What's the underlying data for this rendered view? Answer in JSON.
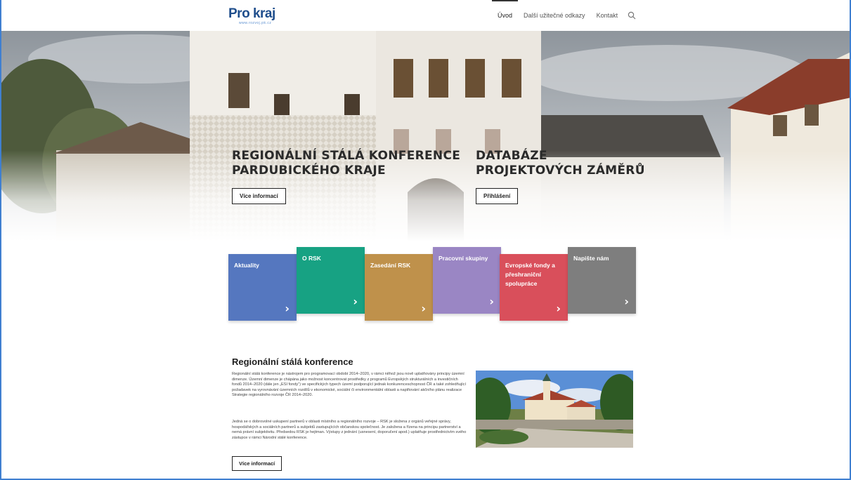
{
  "header": {
    "logo_text": "Pro kraj",
    "logo_subtitle": "www.rozvoj.pk.cz",
    "nav": [
      {
        "label": "Úvod",
        "active": true
      },
      {
        "label": "Další užitečné odkazy",
        "active": false
      },
      {
        "label": "Kontakt",
        "active": false
      }
    ],
    "search_icon": "search-icon"
  },
  "hero": {
    "left": {
      "title_line1": "REGIONÁLNÍ STÁLÁ KONFERENCE",
      "title_line2": "PARDUBICKÉHO KRAJE",
      "button": "Více informací"
    },
    "right": {
      "title_line1": "DATABÁZE",
      "title_line2": "PROJEKTOVÝCH ZÁMĚRŮ",
      "button": "Přihlášení"
    }
  },
  "tiles": [
    {
      "label": "Aktuality",
      "color": "#5577bf"
    },
    {
      "label": "O RSK",
      "color": "#17a283"
    },
    {
      "label": "Zasedání RSK",
      "color": "#bf914b"
    },
    {
      "label": "Pracovní skupiny",
      "color": "#9a86c4"
    },
    {
      "label": "Evropské fondy a přeshraniční spolupráce",
      "color": "#d94f5b"
    },
    {
      "label": "Napište nám",
      "color": "#7e7e7e"
    }
  ],
  "content": {
    "title": "Regionální stálá konference",
    "paragraph1": "Regionální stálá konference je nástrojem pro programovací období 2014–2020, v rámci něhož jsou nově uplatňovány principy územní dimenze. Územní dimenze je chápána jako možnost koncentrovat prostředky z programů Evropských strukturálních a investičních fondů 2014–2020 (dále jen „ESI fondy“) ve specifických typech území podporující jednak konkurenceschopnost ČR a také zohledňující požadavek na vyrovnávání územních rozdílů v ekonomické, sociální či environmentální oblasti a naplňování akčního plánu realizace Strategie regionálního rozvoje ČR 2014–2020.",
    "paragraph2": "Jedná se o dobrovolné uskupení partnerů v oblasti místního a regionálního rozvoje – RSK je složena z orgánů veřejné správy, hospodářských a sociálních partnerů a subjektů zastupujících občanskou společnost. Je založena a řízena na principu partnerství a nemá právní subjektivitu. Předsedou RSK je hejtman. Výstupy z jednání (usnesení, doporučení apod.) uplatňuje prostřednictvím svého zástupce v rámci Národní stálé konference.",
    "button": "Více informací"
  }
}
